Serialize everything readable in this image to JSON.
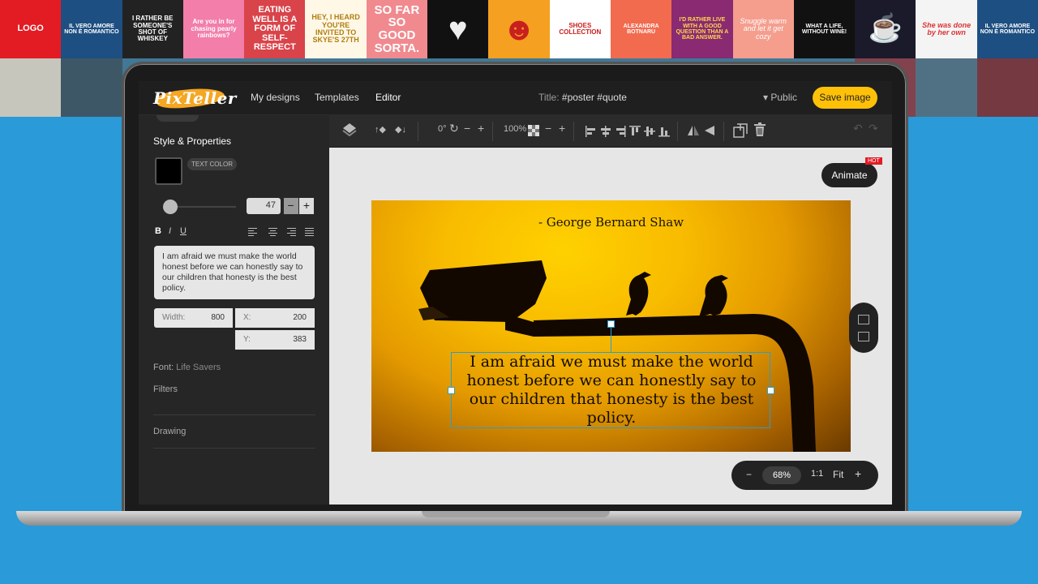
{
  "nav": {
    "logo_text": "PixTeller",
    "my_designs": "My designs",
    "templates": "Templates",
    "editor": "Editor",
    "title_label": "Title:",
    "title_value": "#poster #quote",
    "visibility": "▾ Public",
    "save": "Save image"
  },
  "left_panel": {
    "heading": "Style & Properties",
    "text_color_label": "TEXT COLOR",
    "text_color": "#000000",
    "font_size": "47",
    "bold": "B",
    "italic": "I",
    "underline": "U",
    "text_value": "I am afraid we must make the world honest before we can honestly say to our children that honesty is the best policy.",
    "width_label": "Width:",
    "width_value": "800",
    "x_label": "X:",
    "x_value": "200",
    "y_label": "Y:",
    "y_value": "383",
    "font_label": "Font:",
    "font_value": "Life Savers",
    "filters": "Filters",
    "drawing": "Drawing"
  },
  "toolbar": {
    "rotation": "0°",
    "opacity": "100%"
  },
  "canvas": {
    "animate": "Animate",
    "hot_badge": "HOT",
    "author": "- George Bernard Shaw",
    "quote": "I am afraid we must make the world honest before we can honestly say to our children that honesty is the best policy."
  },
  "zoom": {
    "minus": "−",
    "value": "68%",
    "one_to_one": "1:1",
    "fit": "Fit",
    "plus": "+"
  },
  "background_tiles": [
    {
      "text": "LOGO",
      "bg": "#e31b23"
    },
    {
      "text": "IL VERO AMORE NON È ROMANTICO",
      "bg": "#1d4f82"
    },
    {
      "text": "I RATHER BE SOMEONE'S SHOT OF WHISKEY",
      "bg": "#222222"
    },
    {
      "text": "Are you in for chasing pearly rainbows?",
      "bg": "#f27ea9"
    },
    {
      "text": "EATING WELL IS A FORM OF SELF-RESPECT",
      "bg": "#d9434a"
    },
    {
      "text": "HEY, I HEARD YOU'RE INVITED TO SKYE'S 27TH",
      "bg": "#fff8e6"
    },
    {
      "text": "SO FAR SO GOOD SORTA.",
      "bg": "#f08a8f"
    },
    {
      "text": "♥",
      "bg": "#111111"
    },
    {
      "text": "☻",
      "bg": "#f5a020"
    },
    {
      "text": "SHOES COLLECTION",
      "bg": "#ffffff"
    },
    {
      "text": "ALEXANDRA BOTNARU",
      "bg": "#f26b4f"
    },
    {
      "text": "I'D RATHER LIVE WITH A GOOD QUESTION THAN A BAD ANSWER.",
      "bg": "#8a2a72"
    },
    {
      "text": "Snuggle warm and let it get cozy",
      "bg": "#f59e8e"
    },
    {
      "text": "WHAT A LIFE, WITHOUT WINE!",
      "bg": "#111111"
    },
    {
      "text": "☕",
      "bg": "#1a1a2a"
    },
    {
      "text": "She was done by her own",
      "bg": "#f4f4f4"
    },
    {
      "text": "IL VERO AMORE NON È ROMANTICO",
      "bg": "#1d4f82"
    }
  ]
}
